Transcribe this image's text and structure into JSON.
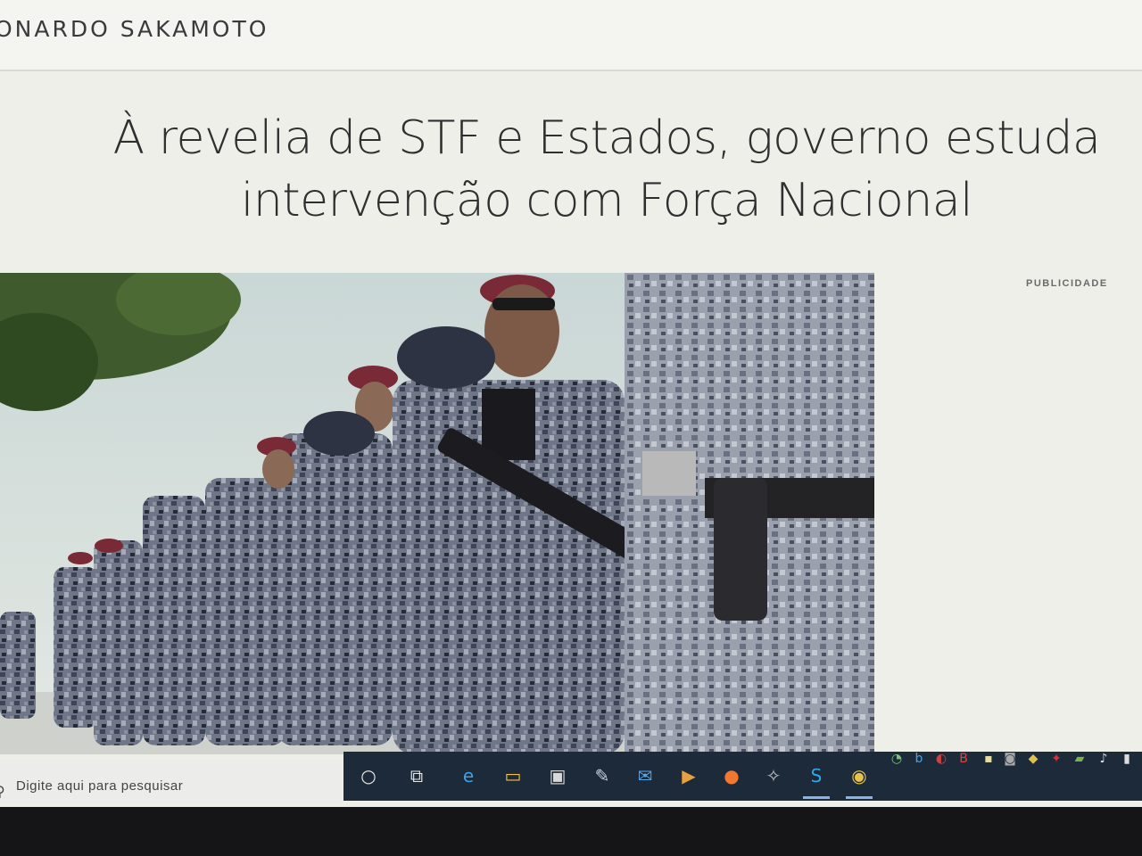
{
  "header": {
    "author": "ONARDO SAKAMOTO"
  },
  "article": {
    "headline": "À revelia de STF e Estados, governo estuda intervenção com Força Nacional",
    "headline_line1": "À revelia de STF e Estados, governo estuda",
    "headline_line2": "intervenção com Força Nacional",
    "ad_label": "PUBLICIDADE",
    "photo": "soldiers-marching-photo"
  },
  "taskbar": {
    "search_placeholder": "Digite aqui para pesquisar",
    "apps": [
      "cortana-icon",
      "task-view-icon",
      "edge-icon",
      "file-explorer-icon",
      "store-icon",
      "paint-icon",
      "mail-icon",
      "media-icon",
      "firefox-icon",
      "app-icon",
      "skype-icon",
      "chrome-icon"
    ],
    "tray_icons": [
      "tray-icon",
      "bing-icon",
      "tray-icon",
      "tray-icon",
      "tray-icon",
      "tray-icon",
      "tray-icon",
      "tray-icon",
      "acrobat-icon",
      "nvidia-icon",
      "volume-icon",
      "battery-icon"
    ]
  },
  "colors": {
    "taskbar": "#1d2a3a",
    "page_bg": "#efefea",
    "headline": "#2f2f30"
  }
}
